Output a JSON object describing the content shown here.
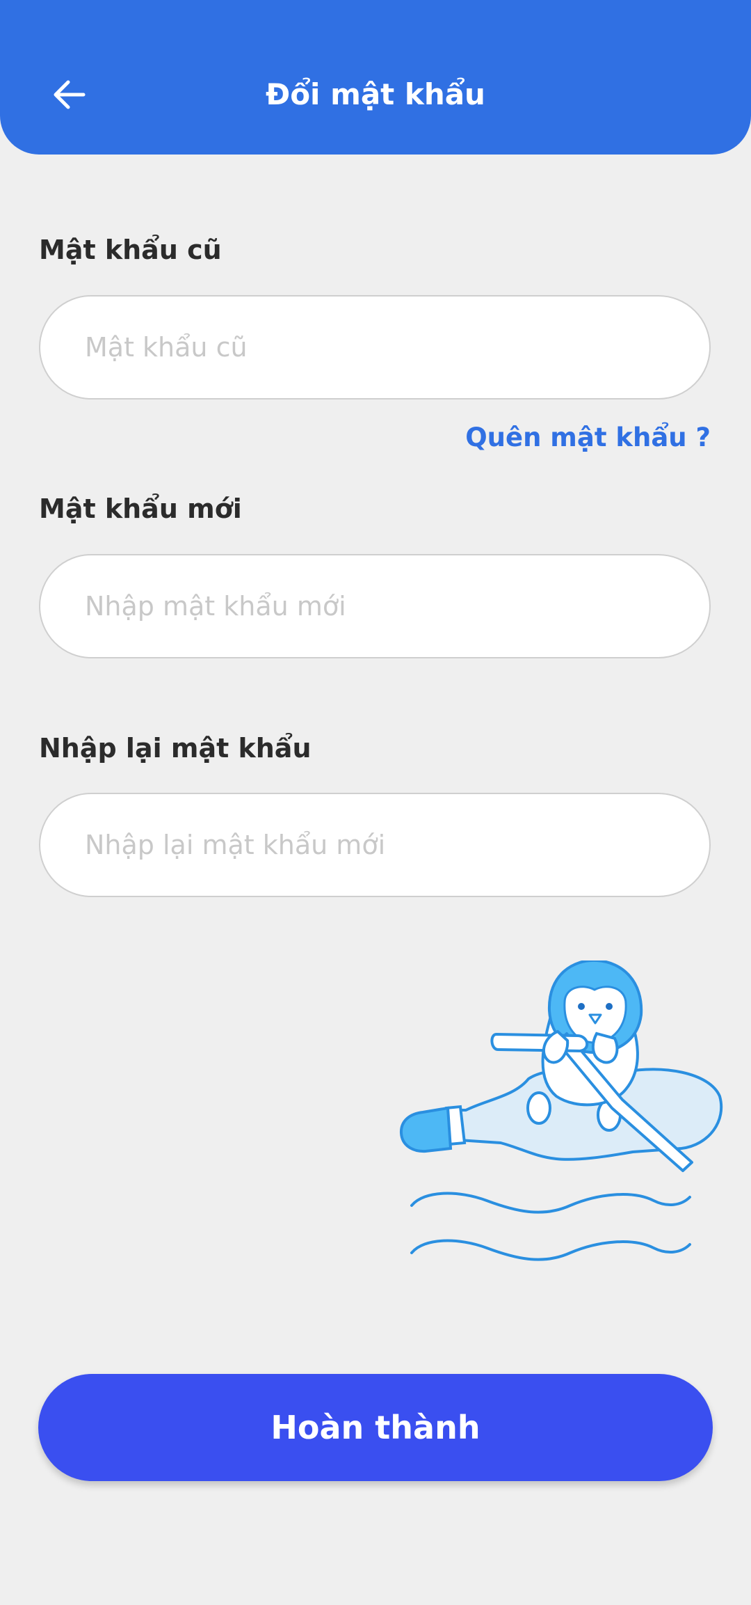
{
  "header": {
    "title": "Đổi mật khẩu",
    "back_icon": "arrow-left-icon"
  },
  "form": {
    "old_password": {
      "label": "Mật khẩu cũ",
      "placeholder": "Mật khẩu cũ",
      "value": ""
    },
    "forgot_password_link": "Quên mật khẩu ?",
    "new_password": {
      "label": "Mật khẩu mới",
      "placeholder": "Nhập mật khẩu mới",
      "value": ""
    },
    "confirm_password": {
      "label": "Nhập lại mật khẩu",
      "placeholder": "Nhập lại mật khẩu mới",
      "value": ""
    }
  },
  "illustration": {
    "icon": "penguin-rowing-bottle-illustration"
  },
  "submit_button": {
    "label": "Hoàn thành"
  },
  "colors": {
    "header_bg": "#3070e3",
    "page_bg": "#efefef",
    "link": "#3070e3",
    "primary_button": "#3a4ff0",
    "placeholder": "#c8c8c8",
    "label": "#2b2b2b",
    "illustration_stroke": "#2a8fe0",
    "illustration_fill": "#dcecf8"
  }
}
